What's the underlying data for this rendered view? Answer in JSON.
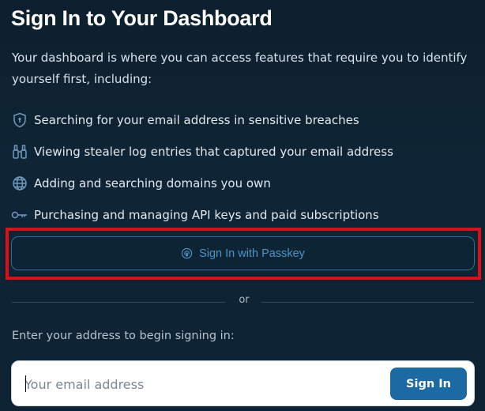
{
  "page": {
    "title": "Sign In to Your Dashboard",
    "intro": "Your dashboard is where you can access features that require you to identify yourself first, including:"
  },
  "features": [
    {
      "icon": "shield-icon",
      "text": "Searching for your email address in sensitive breaches"
    },
    {
      "icon": "binoculars-icon",
      "text": "Viewing stealer log entries that captured your email address"
    },
    {
      "icon": "globe-icon",
      "text": "Adding and searching domains you own"
    },
    {
      "icon": "key-icon",
      "text": "Purchasing and managing API keys and paid subscriptions"
    }
  ],
  "passkey": {
    "label": "Sign In with Passkey",
    "icon": "fingerprint-icon"
  },
  "divider": {
    "label": "or"
  },
  "email_form": {
    "prompt": "Enter your address to begin signing in:",
    "placeholder": "Your email address",
    "value": "",
    "submit_label": "Sign In"
  },
  "colors": {
    "background": "#0d1f2d",
    "accent": "#1c6aa3",
    "passkey_text": "#4b94c7",
    "highlight": "#e10d14"
  }
}
